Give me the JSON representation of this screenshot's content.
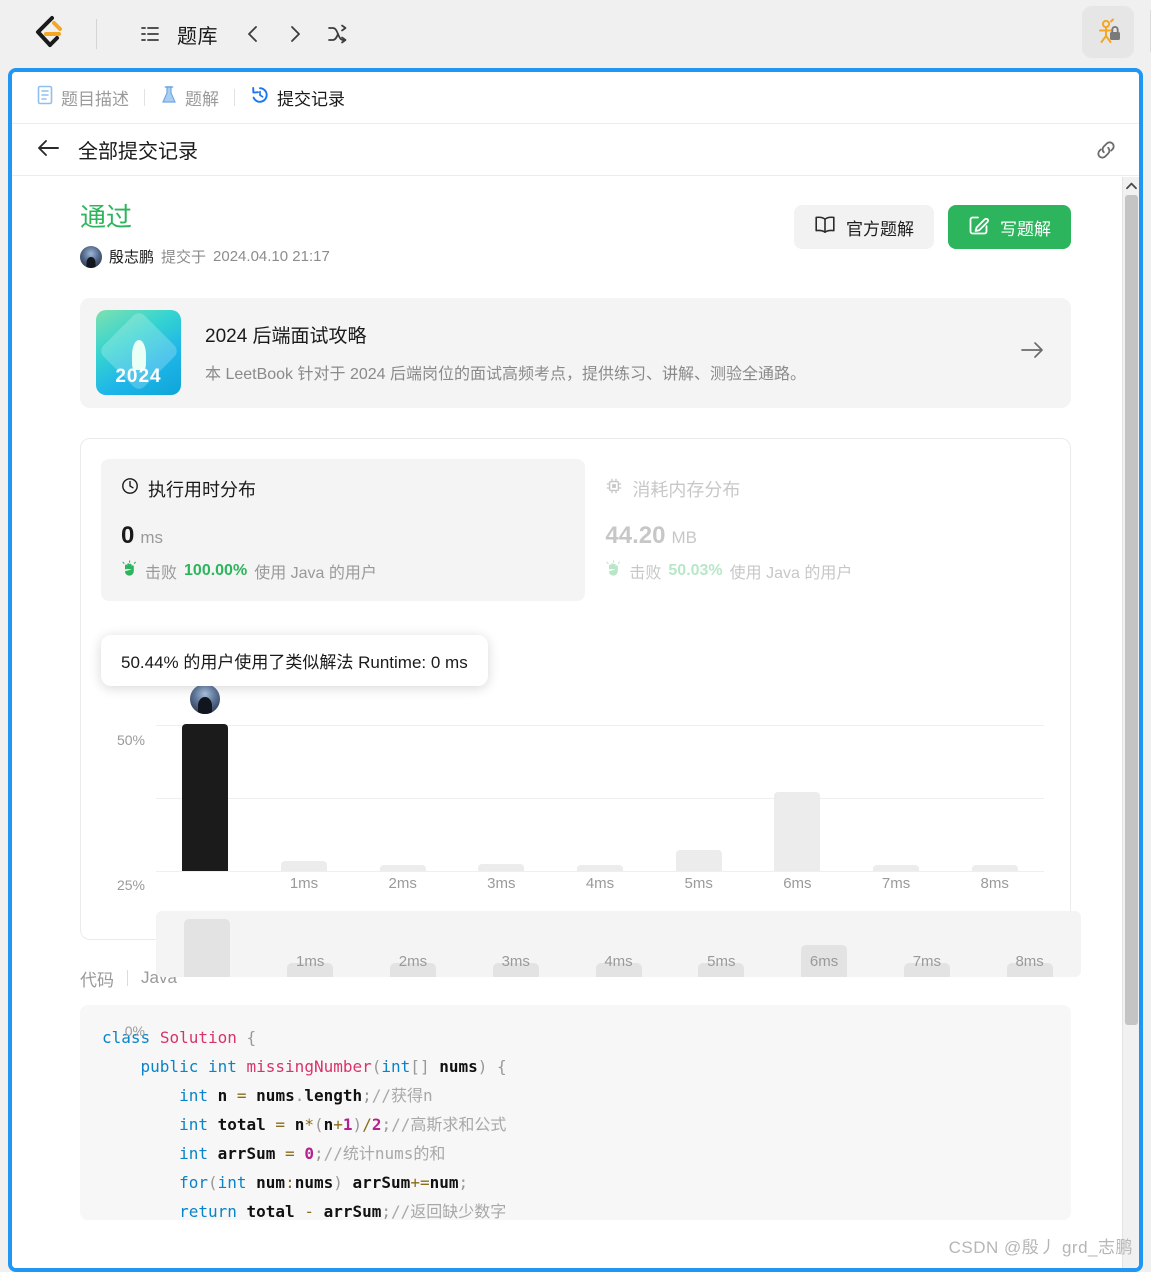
{
  "topbar": {
    "logo_icon": "leetcode-logo-icon",
    "menu_icon": "list-menu-icon",
    "nav_label": "题库",
    "prev_icon": "chevron-left-icon",
    "next_icon": "chevron-right-icon",
    "shuffle_icon": "shuffle-icon",
    "account_icon": "user-lock-icon"
  },
  "tabs": [
    {
      "label": "题目描述",
      "icon": "document-icon",
      "active": false
    },
    {
      "label": "题解",
      "icon": "flask-icon",
      "active": false
    },
    {
      "label": "提交记录",
      "icon": "history-icon",
      "active": true
    }
  ],
  "subheader": {
    "back_icon": "arrow-left-icon",
    "title": "全部提交记录",
    "link_icon": "link-icon"
  },
  "submission": {
    "verdict": "通过",
    "verdict_color": "#2db55d",
    "avatar_icon": "user-avatar",
    "submitter": "殷志鹏",
    "submitted_prefix": "提交于",
    "submitted_at": "2024.04.10 21:17",
    "official_solution_button": "官方题解",
    "official_solution_icon": "book-icon",
    "write_solution_button": "写题解",
    "write_solution_icon": "pencil-square-icon",
    "write_solution_color": "#2db55d"
  },
  "banner": {
    "cover_year": "2024",
    "title": "2024 后端面试攻略",
    "description": "本 LeetBook 针对于 2024 后端岗位的面试高频考点，提供练习、讲解、测验全通路。",
    "arrow_icon": "arrow-right-icon"
  },
  "stats": {
    "runtime": {
      "icon": "clock-icon",
      "title": "执行用时分布",
      "value": "0",
      "unit": "ms",
      "beat_icon": "hand-icon",
      "beat_prefix": "击败",
      "beat_percent": "100.00%",
      "beat_suffix_lang": "使用 Java 的用户"
    },
    "memory": {
      "icon": "chip-icon",
      "title": "消耗内存分布",
      "value": "44.20",
      "unit": "MB",
      "beat_icon": "hand-icon",
      "beat_prefix": "击败",
      "beat_percent": "50.03%",
      "beat_suffix_lang": "使用 Java 的用户"
    }
  },
  "chart_data": {
    "type": "bar",
    "title": "执行用时分布",
    "tooltip": "50.44% 的用户使用了类似解法 Runtime: 0 ms",
    "xlabel": "",
    "ylabel": "",
    "ylim": [
      0,
      55
    ],
    "yticks": [
      "0%",
      "25%",
      "50%"
    ],
    "ytick_values": [
      0,
      25,
      50
    ],
    "grid": true,
    "legend": "none",
    "categories": [
      "0ms",
      "1ms",
      "2ms",
      "3ms",
      "4ms",
      "5ms",
      "6ms",
      "7ms",
      "8ms"
    ],
    "tick_labels": [
      "",
      "1ms",
      "2ms",
      "3ms",
      "4ms",
      "5ms",
      "6ms",
      "7ms",
      "8ms"
    ],
    "values": [
      50.44,
      3.2,
      2.0,
      2.2,
      1.9,
      7.0,
      27.0,
      2.0,
      1.8
    ],
    "highlight_index": 0,
    "highlight_color": "#1b1b1b",
    "bar_color": "#ececec",
    "marker": {
      "index": 0,
      "icon": "user-avatar"
    },
    "brush": {
      "categories": [
        "0ms",
        "1ms",
        "2ms",
        "3ms",
        "4ms",
        "5ms",
        "6ms",
        "7ms",
        "8ms"
      ],
      "tick_labels": [
        "",
        "1ms",
        "2ms",
        "3ms",
        "4ms",
        "5ms",
        "6ms",
        "7ms",
        "8ms"
      ],
      "values": [
        50.44,
        3.2,
        2.0,
        2.2,
        1.9,
        7.0,
        27.0,
        2.0,
        1.8
      ]
    }
  },
  "code": {
    "section_label": "代码",
    "language": "Java",
    "lines": [
      "class Solution {",
      "    public int missingNumber(int[] nums) {",
      "        int n = nums.length;//获得n",
      "        int total = n*(n+1)/2;//高斯求和公式",
      "        int arrSum = 0;//统计nums的和",
      "        for(int num:nums) arrSum+=num;",
      "        return total - arrSum;//返回缺少数字"
    ]
  },
  "scrollbar": {
    "up_icon": "chevron-up-icon"
  },
  "watermark": "CSDN @殷丿 grd_志鹏"
}
